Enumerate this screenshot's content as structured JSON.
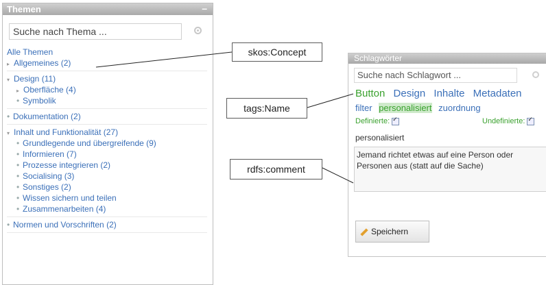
{
  "themen": {
    "title": "Themen",
    "collapse": "–",
    "search_placeholder": "Suche nach Thema ...",
    "all_link": "Alle Themen",
    "items": [
      {
        "label": "Allgemeines (2)",
        "level": 0,
        "marker": "▸"
      },
      {
        "label": "Design (11)",
        "level": 0,
        "marker": "▾"
      },
      {
        "label": "Oberfläche (4)",
        "level": 1,
        "marker": "▸"
      },
      {
        "label": "Symbolik",
        "level": 1,
        "marker": "•"
      },
      {
        "label": "Dokumentation (2)",
        "level": 0,
        "marker": "•"
      },
      {
        "label": "Inhalt und Funktionalität (27)",
        "level": 0,
        "marker": "▾"
      },
      {
        "label": "Grundlegende und übergreifende (9)",
        "level": 1,
        "marker": "•"
      },
      {
        "label": "Informieren (7)",
        "level": 1,
        "marker": "•"
      },
      {
        "label": "Prozesse integrieren (2)",
        "level": 1,
        "marker": "•"
      },
      {
        "label": "Socialising (3)",
        "level": 1,
        "marker": "•"
      },
      {
        "label": "Sonstiges (2)",
        "level": 1,
        "marker": "•"
      },
      {
        "label": "Wissen sichern und teilen",
        "level": 1,
        "marker": "•"
      },
      {
        "label": "Zusammenarbeiten (4)",
        "level": 1,
        "marker": "•"
      },
      {
        "label": "Normen und Vorschriften (2)",
        "level": 0,
        "marker": "•"
      }
    ]
  },
  "schlagwoerter": {
    "title": "Schlagwörter",
    "search_placeholder": "Suche nach Schlagwort ...",
    "tags_row1": [
      "Button",
      "Design",
      "Inhalte",
      "Metadaten"
    ],
    "tags_row2": [
      "filter",
      "personalisiert",
      "zuordnung"
    ],
    "defined_label": "Definierte:",
    "undefined_label": "Undefinierte:",
    "selected_tag": "personalisiert",
    "comment": "Jemand richtet etwas auf eine Person oder Personen aus (statt auf die Sache)",
    "save_label": "Speichern"
  },
  "labels": {
    "concept": "skos:Concept",
    "tagname": "tags:Name",
    "comment": "rdfs:comment"
  }
}
